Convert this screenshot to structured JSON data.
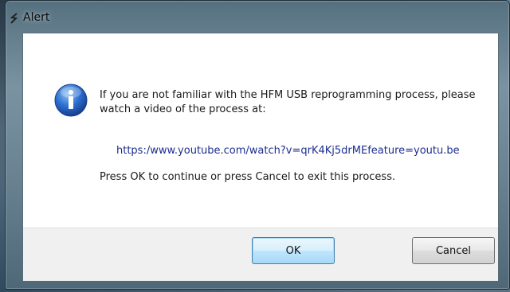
{
  "window": {
    "title": "Alert",
    "icons": {
      "title_icon": "app-icon",
      "message_icon": "info-icon"
    }
  },
  "dialog": {
    "message": "If you are not familiar with the HFM USB reprogramming process, please watch a video of the process at:",
    "link": "https:/www.youtube.com/watch?v=qrK4Kj5drMEfeature=youtu.be",
    "prompt": "Press OK to continue or press Cancel to exit this process."
  },
  "buttons": {
    "ok_label": "OK",
    "cancel_label": "Cancel"
  },
  "colors": {
    "link": "#1d2d8f",
    "ok_focus_border": "#3c7fb1"
  }
}
